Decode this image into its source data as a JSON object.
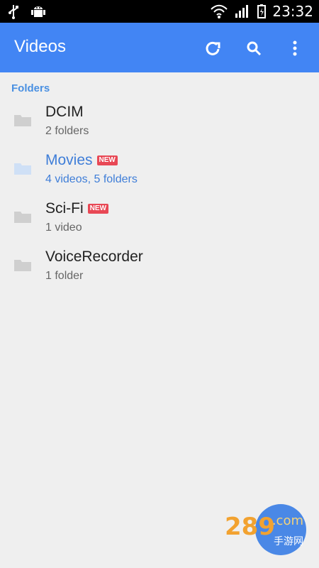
{
  "statusbar": {
    "time": "23:32"
  },
  "appbar": {
    "title": "Videos",
    "actions": {
      "refresh": "refresh-icon",
      "search": "search-icon",
      "more": "more-vert-icon"
    },
    "colors": {
      "appbar": "#4285f4"
    }
  },
  "content": {
    "section_title": "Folders",
    "items": [
      {
        "name": "DCIM",
        "subtitle": "2 folders",
        "badge": "",
        "active": false
      },
      {
        "name": "Movies",
        "subtitle": "4 videos, 5 folders",
        "badge": "NEW",
        "active": true
      },
      {
        "name": "Sci-Fi",
        "subtitle": "1 video",
        "badge": "NEW",
        "active": false
      },
      {
        "name": "VoiceRecorder",
        "subtitle": "1 folder",
        "badge": "",
        "active": false
      }
    ]
  },
  "watermark": {
    "logo": "289",
    "com": ".com",
    "cn": "手游网"
  }
}
